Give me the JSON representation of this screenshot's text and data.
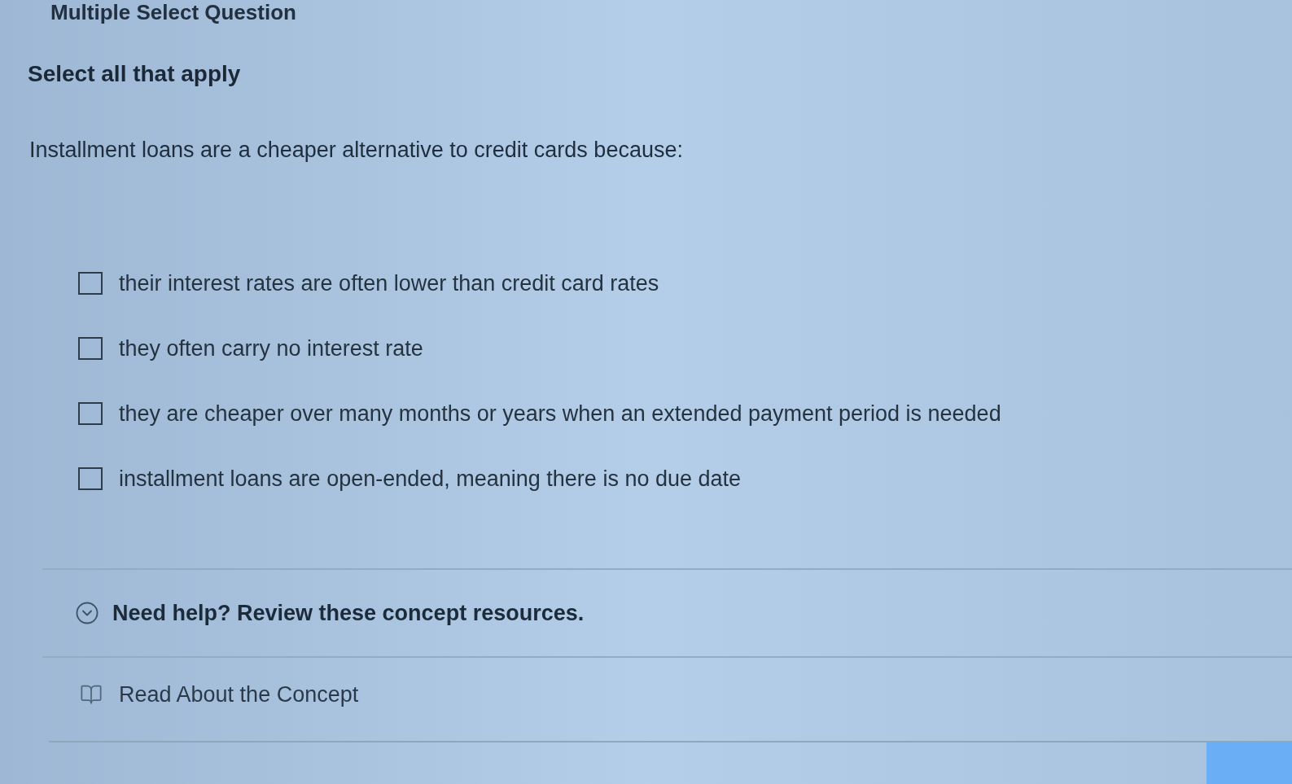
{
  "header": {
    "title": "Multiple Select Question",
    "instruction": "Select all that apply"
  },
  "question": "Installment loans are a cheaper alternative to credit cards because:",
  "options": [
    {
      "label": "their interest rates are often lower than credit card rates",
      "checked": false
    },
    {
      "label": "they often carry no interest rate",
      "checked": false
    },
    {
      "label": "they are cheaper over many months or years when an extended payment period is needed",
      "checked": false
    },
    {
      "label": "installment loans are open-ended, meaning there is no due date",
      "checked": false
    }
  ],
  "help": {
    "label": "Need help? Review these concept resources."
  },
  "resources": [
    {
      "label": "Read About the Concept"
    }
  ]
}
